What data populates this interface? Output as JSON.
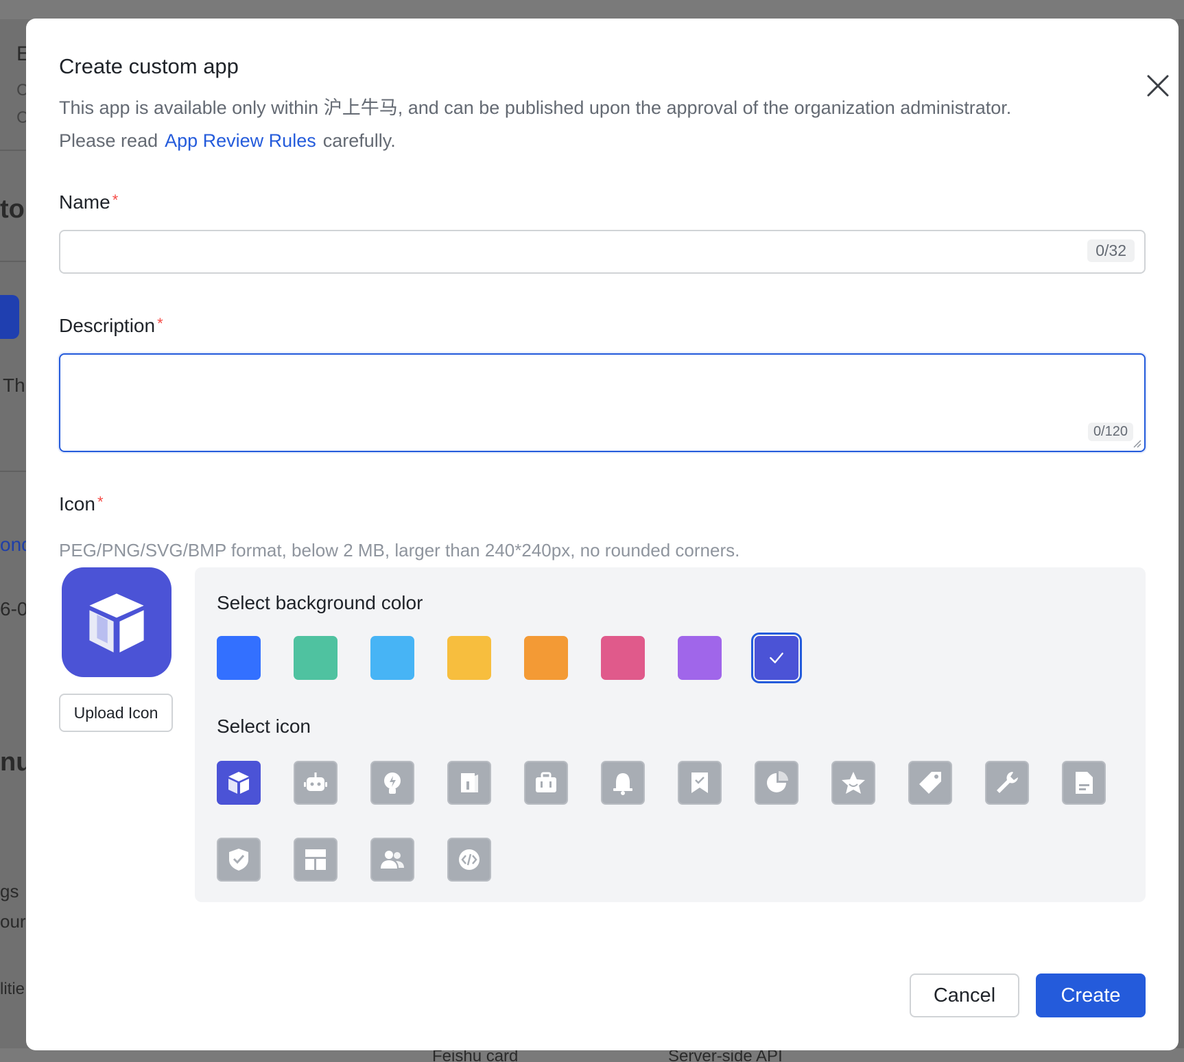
{
  "background": {
    "fragments": [
      "E",
      "C",
      "C",
      "tor",
      "Th",
      "ond",
      "6-0",
      "nu",
      "gs",
      "our",
      "litie",
      "Feishu card",
      "Server-side API"
    ]
  },
  "dialog": {
    "title": "Create custom app",
    "description_line1": "This app is available only within 沪上牛马, and can be published upon the approval of the organization administrator.",
    "description_prefix": "Please read",
    "review_link": "App Review Rules",
    "description_suffix": "carefully.",
    "close_icon": "close-icon"
  },
  "name_field": {
    "label": "Name",
    "required_mark": "*",
    "value": "",
    "counter": "0/32"
  },
  "description_field": {
    "label": "Description",
    "required_mark": "*",
    "value": "",
    "counter": "0/120"
  },
  "icon_field": {
    "label": "Icon",
    "required_mark": "*",
    "hint": "PEG/PNG/SVG/BMP format, below 2 MB, larger than 240*240px, no rounded corners.",
    "upload_label": "Upload Icon",
    "color_title": "Select background color",
    "icon_title": "Select icon",
    "colors": [
      "#3370ff",
      "#4fc2a0",
      "#47b4f5",
      "#f7be3e",
      "#f39a35",
      "#e05a8b",
      "#a066ea",
      "#4b53d6"
    ],
    "selected_color": "#4b53d6",
    "icons": [
      "box-icon",
      "robot-icon",
      "lightbulb-icon",
      "book-icon",
      "briefcase-icon",
      "bell-icon",
      "bookmark-check-icon",
      "pie-chart-icon",
      "star-icon",
      "tag-icon",
      "wrench-icon",
      "document-icon",
      "shield-check-icon",
      "layout-icon",
      "people-icon",
      "code-icon"
    ],
    "selected_icon": "box-icon"
  },
  "footer": {
    "cancel_label": "Cancel",
    "create_label": "Create"
  }
}
